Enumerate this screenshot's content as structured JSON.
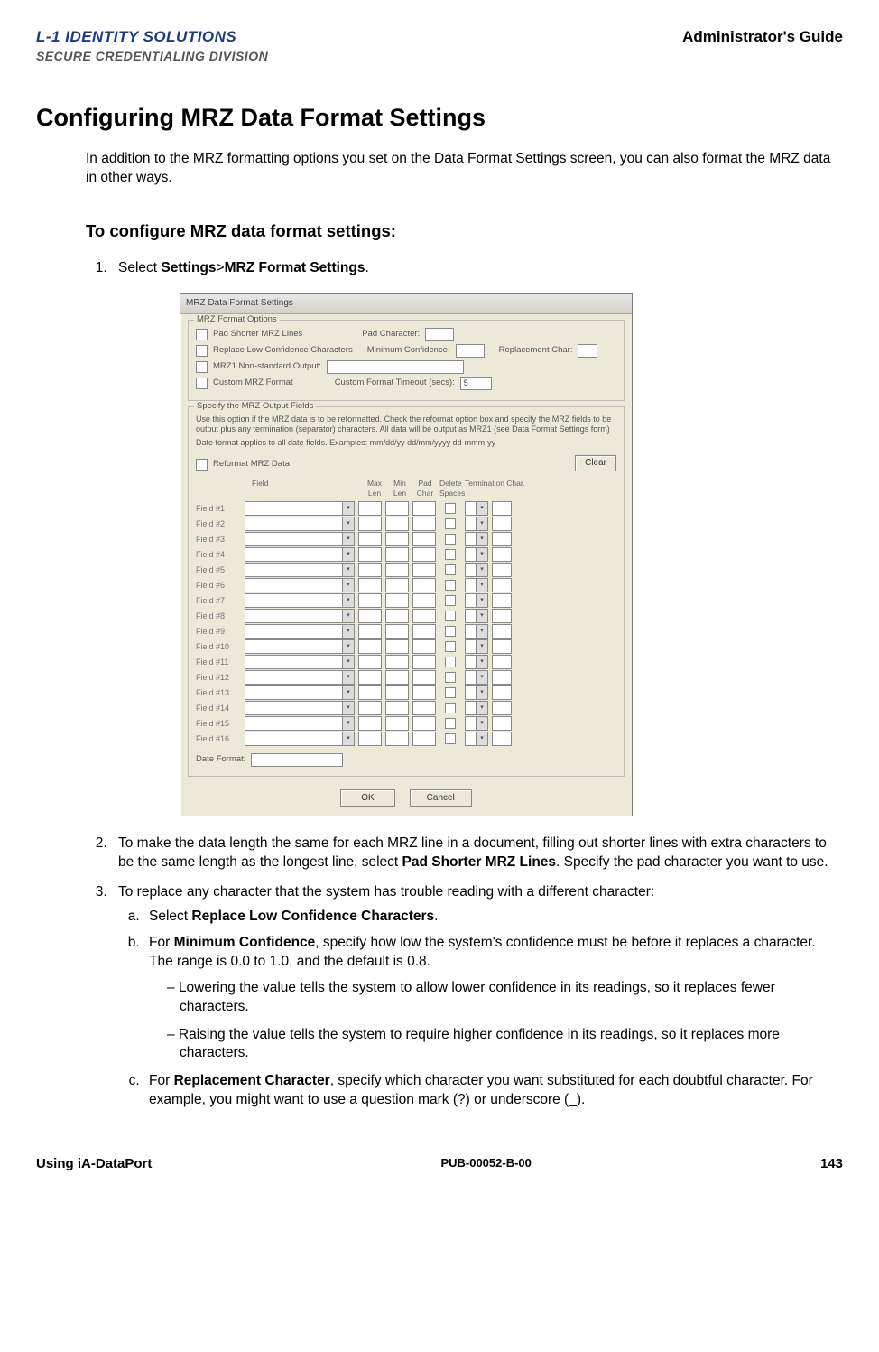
{
  "header": {
    "logo_line1": "L-1 IDENTITY SOLUTIONS",
    "logo_line2": "SECURE CREDENTIALING DIVISION",
    "right": "Administrator's Guide"
  },
  "title": "Configuring MRZ Data Format Settings",
  "intro": "In addition to the MRZ formatting options you set on the Data Format Settings screen, you can also format the MRZ data in other ways.",
  "subtitle": "To configure MRZ data format settings:",
  "step1_prefix": "Select ",
  "step1_b1": "Settings",
  "step1_sep": ">",
  "step1_b2": "MRZ Format Settings",
  "step1_suffix": ".",
  "dialog": {
    "title": "MRZ Data Format Settings",
    "group1": {
      "title": "MRZ Format Options",
      "pad_shorter": "Pad Shorter MRZ Lines",
      "pad_char": "Pad Character:",
      "replace_low": "Replace Low Confidence Characters",
      "min_conf": "Minimum Confidence:",
      "repl_char": "Replacement Char:",
      "nonstd": "MRZ1 Non-standard Output:",
      "custom_fmt": "Custom MRZ Format",
      "custom_timeout": "Custom Format Timeout (secs):",
      "timeout_val": "5"
    },
    "group2": {
      "title": "Specify the MRZ Output Fields",
      "desc1": "Use this option if the MRZ data is to be reformatted. Check the reformat option box and specify the MRZ fields to be output plus any termination (separator) characters. All data will be output as MRZ1 (see Data Format Settings form)",
      "desc2": "Date format applies to all date fields. Examples: mm/dd/yy  dd/mm/yyyy  dd-mmm-yy",
      "reformat": "Reformat MRZ Data",
      "clear": "Clear",
      "hdr_field": "Field",
      "hdr_max": "Max Len",
      "hdr_min": "Min Len",
      "hdr_pad": "Pad Char",
      "hdr_del": "Delete Spaces",
      "hdr_term": "Termination Char.",
      "fields": [
        "Field #1",
        "Field #2",
        "Field #3",
        "Field #4",
        "Field #5",
        "Field #6",
        "Field #7",
        "Field #8",
        "Field #9",
        "Field #10",
        "Field #11",
        "Field #12",
        "Field #13",
        "Field #14",
        "Field #15",
        "Field #16"
      ],
      "date_format": "Date Format:"
    },
    "ok": "OK",
    "cancel": "Cancel"
  },
  "step2_a": "To make the data length the same for each MRZ line in a document, filling out shorter lines with extra characters to be the same length as the longest line, select ",
  "step2_b": "Pad Shorter MRZ Lines",
  "step2_c": ". Specify the pad character you want to use.",
  "step3": "To replace any character that the system has trouble reading with a different character:",
  "s3a_a": "Select ",
  "s3a_b": "Replace Low Confidence Characters",
  "s3a_c": ".",
  "s3b_a": "For ",
  "s3b_b": "Minimum Confidence",
  "s3b_c": ", specify how low the system's confidence must be before it replaces a character. The range is 0.0 to 1.0, and the default is 0.8.",
  "s3b_dash1": "– Lowering the value tells the system to allow lower confidence in its readings, so it replaces fewer characters.",
  "s3b_dash2": "– Raising the value tells the system to require higher confidence in its readings, so it replaces more characters.",
  "s3c_a": "For ",
  "s3c_b": "Replacement Character",
  "s3c_c": ", specify which character you want substituted for each doubtful character. For example, you might want to use a question mark (?) or underscore (_).",
  "footer": {
    "left": "Using iA-DataPort",
    "center": "PUB-00052-B-00",
    "right": "143"
  }
}
